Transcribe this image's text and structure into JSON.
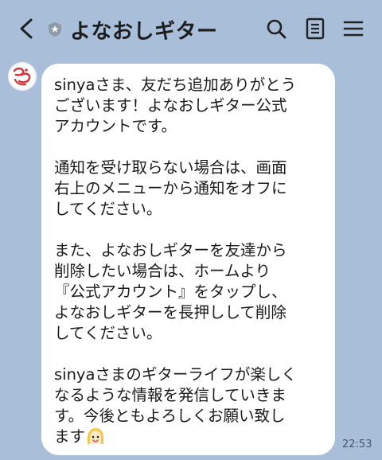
{
  "header": {
    "title": "よなおしギター"
  },
  "message": {
    "paragraphs": [
      "sinyaさま、友だち追加ありがとう\nございます！よなおしギター公式\nアカウントです。",
      "通知を受け取らない場合は、画面\n右上のメニューから通知をオフに\nしてください。",
      "また、よなおしギターを友達から\n削除したい場合は、ホームより\n『公式アカウント』をタップし、\nよなおしギターを長押しして削除\nしてください。",
      "sinyaさまのギターライフが楽しく\nなるような情報を発信していきま\nす。今後ともよろしくお願い致し\nます"
    ],
    "time": "22:53"
  },
  "icons": {
    "back": "back-chevron-icon",
    "verified": "shield-icon",
    "search": "search-icon",
    "notes": "notes-icon",
    "menu": "menu-icon",
    "avatar": "avatar-logo",
    "emoji": "smiling-face-emoji"
  },
  "colors": {
    "background": "#a9bfd9",
    "bubble": "#ffffff",
    "avatar_accent": "#d9373e"
  }
}
